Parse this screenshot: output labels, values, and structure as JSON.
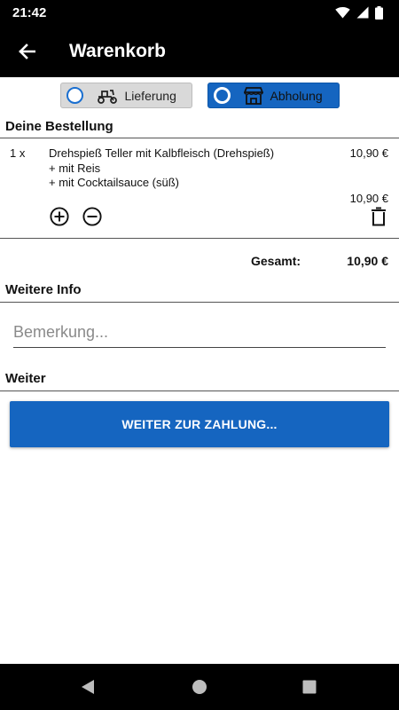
{
  "status": {
    "time": "21:42"
  },
  "app_bar": {
    "title": "Warenkorb"
  },
  "mode": {
    "delivery_label": "Lieferung",
    "pickup_label": "Abholung",
    "selected": "pickup",
    "colors": {
      "active": "#1565c0",
      "inactive": "#d9d9d9"
    }
  },
  "order": {
    "heading": "Deine Bestellung",
    "items": [
      {
        "qty": "1 x",
        "name": "Drehspieß Teller mit Kalbfleisch (Drehspieß)",
        "price": "10,90 €",
        "extras": [
          "+ mit Reis",
          "+ mit Cocktailsauce (süß)"
        ],
        "line_total": "10,90 €"
      }
    ],
    "total_label": "Gesamt:",
    "total_value": "10,90 €"
  },
  "info": {
    "heading": "Weitere Info",
    "remark_placeholder": "Bemerkung..."
  },
  "next": {
    "heading": "Weiter",
    "button_label": "WEITER ZUR ZAHLUNG..."
  },
  "icons": [
    "wifi-icon",
    "signal-icon",
    "battery-icon",
    "back-arrow-icon",
    "scooter-icon",
    "store-icon",
    "plus-circle-icon",
    "minus-circle-icon",
    "trash-icon",
    "nav-back-icon",
    "nav-home-icon",
    "nav-recents-icon"
  ]
}
